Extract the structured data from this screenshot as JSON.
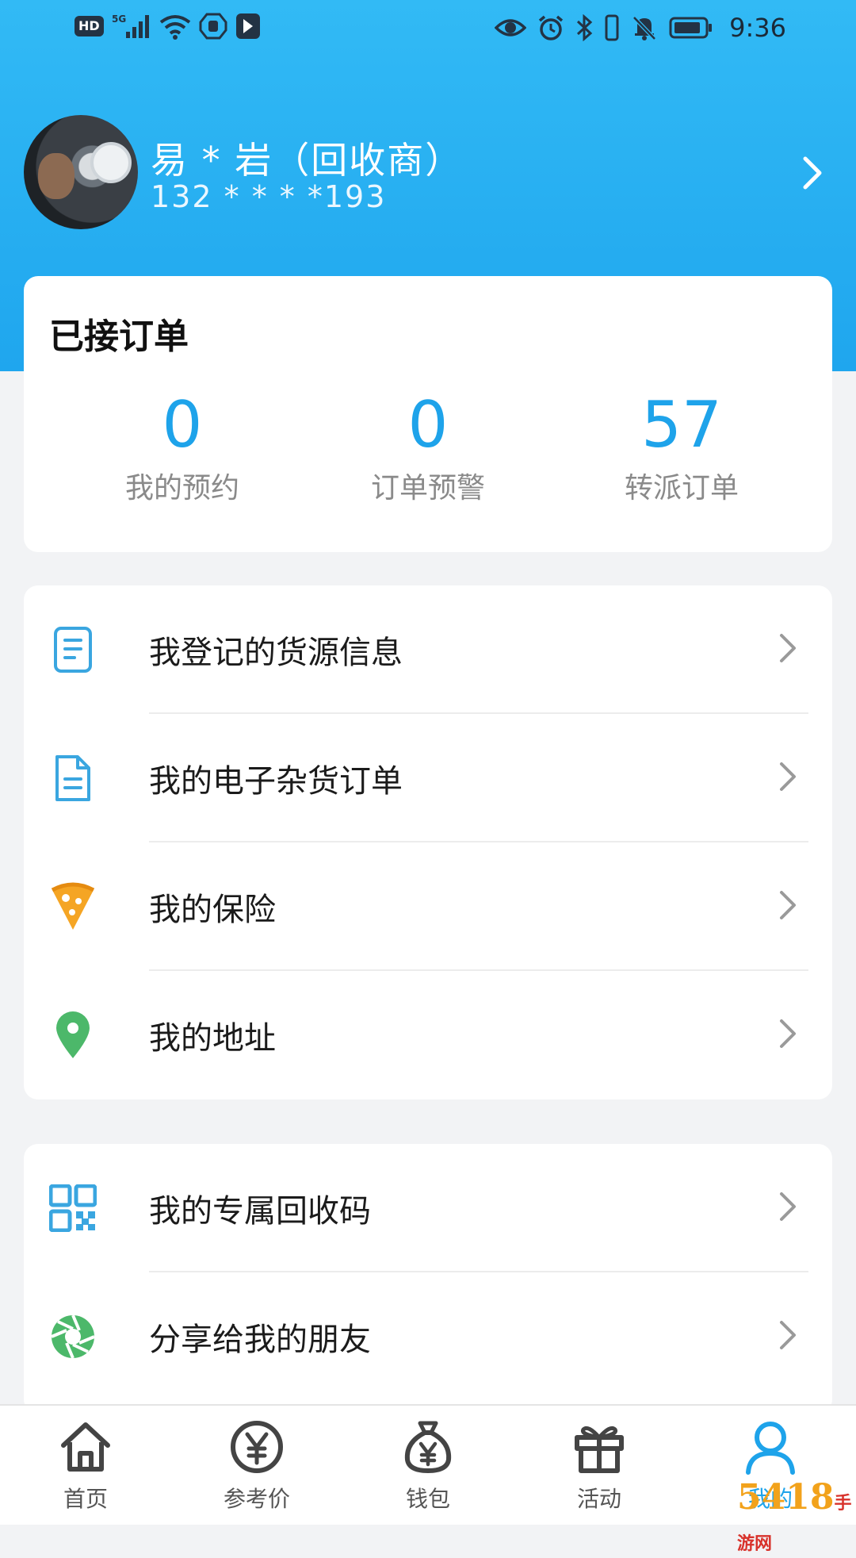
{
  "status_bar": {
    "hd": "HD",
    "network": "5G",
    "time": "9:36"
  },
  "profile": {
    "name": "易 * 岩（回收商）",
    "phone": "132 * * * *193"
  },
  "orders": {
    "title": "已接订单",
    "stats": [
      {
        "value": "0",
        "label": "我的预约"
      },
      {
        "value": "0",
        "label": "订单预警"
      },
      {
        "value": "57",
        "label": "转派订单"
      }
    ]
  },
  "menu_group_1": [
    {
      "label": "我登记的货源信息",
      "icon": "document-icon"
    },
    {
      "label": "我的电子杂货订单",
      "icon": "file-icon"
    },
    {
      "label": "我的保险",
      "icon": "pizza-slice-icon"
    },
    {
      "label": "我的地址",
      "icon": "location-pin-icon"
    }
  ],
  "menu_group_2": [
    {
      "label": "我的专属回收码",
      "icon": "qr-code-icon"
    },
    {
      "label": "分享给我的朋友",
      "icon": "aperture-icon"
    }
  ],
  "bottom_nav": [
    {
      "label": "首页",
      "icon": "home-icon"
    },
    {
      "label": "参考价",
      "icon": "yen-circle-icon"
    },
    {
      "label": "钱包",
      "icon": "money-bag-icon"
    },
    {
      "label": "活动",
      "icon": "gift-icon"
    },
    {
      "label": "我的",
      "icon": "person-icon",
      "active": true
    }
  ],
  "watermark": {
    "main": "5418",
    "sub": "手游网"
  },
  "colors": {
    "accent": "#1ea3ea",
    "header_top": "#32baf5",
    "header_bottom": "#1fa6ee"
  }
}
